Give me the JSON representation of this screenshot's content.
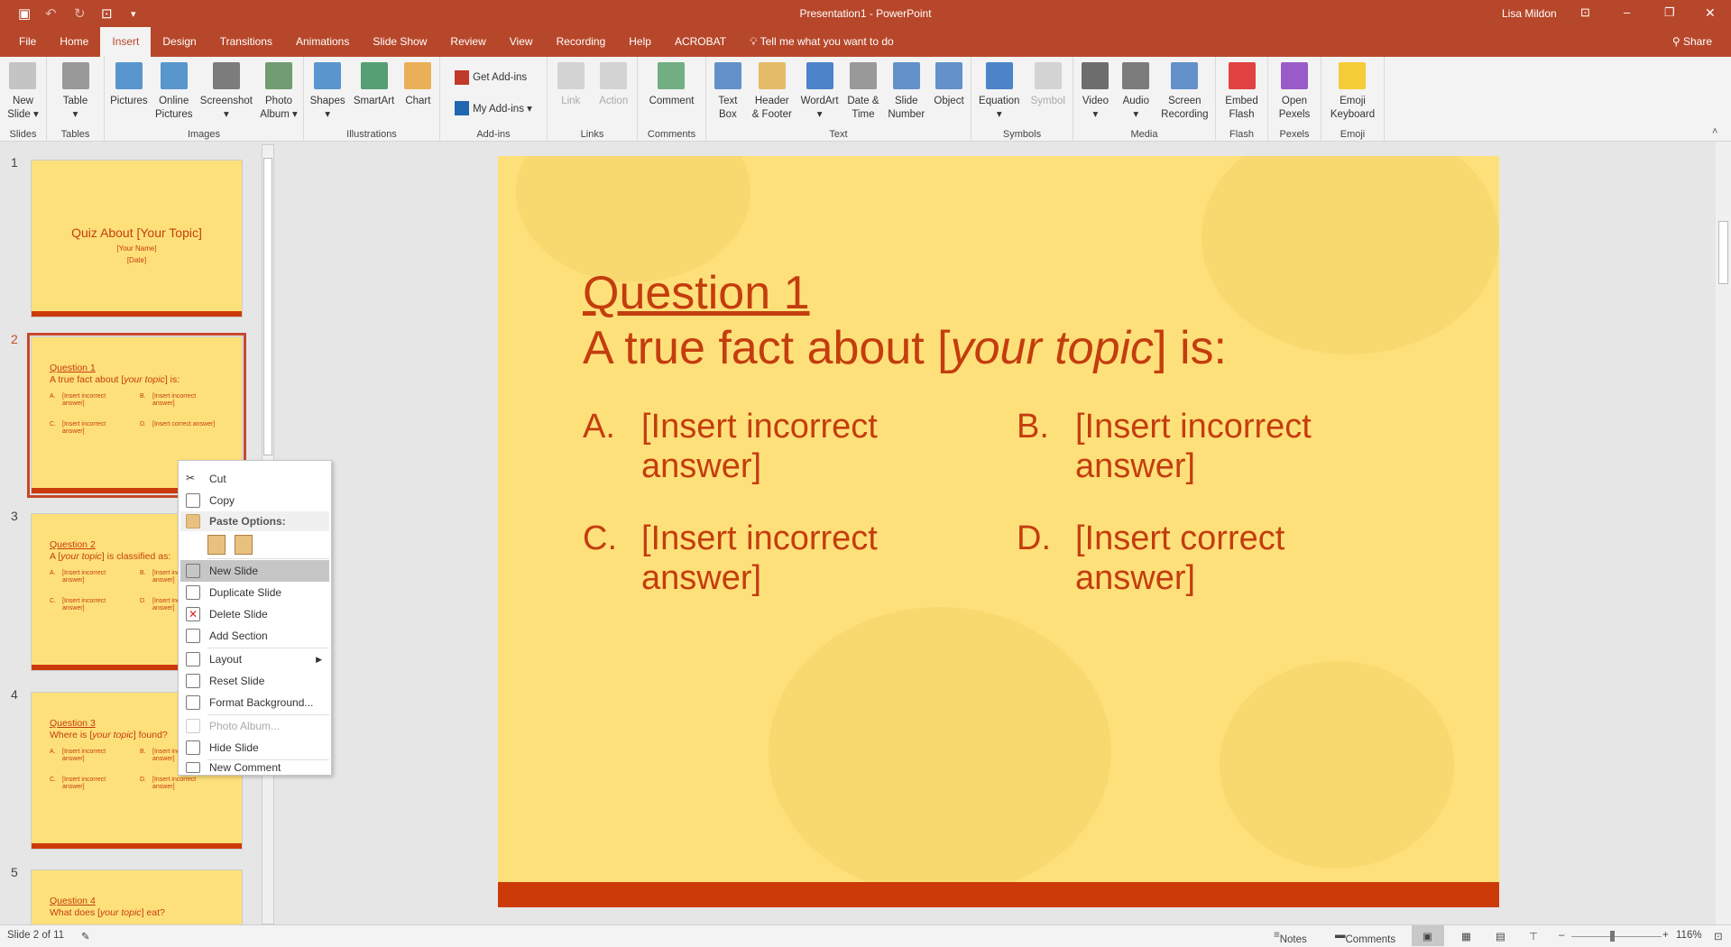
{
  "titlebar": {
    "title": "Presentation1  -  PowerPoint",
    "user": "Lisa Mildon"
  },
  "tabs": [
    "File",
    "Home",
    "Insert",
    "Design",
    "Transitions",
    "Animations",
    "Slide Show",
    "Review",
    "View",
    "Recording",
    "Help",
    "ACROBAT"
  ],
  "active_tab": "Insert",
  "tell_me": "Tell me what you want to do",
  "share": "Share",
  "ribbon": [
    {
      "label": "Slides",
      "w": 52,
      "items": [
        {
          "l1": "New",
          "l2": "Slide ▾",
          "c": "#bbb"
        }
      ]
    },
    {
      "label": "Tables",
      "w": 64,
      "items": [
        {
          "l1": "Table",
          "l2": "▾",
          "c": "#888"
        }
      ]
    },
    {
      "label": "Images",
      "w": 221,
      "items": [
        {
          "l1": "Pictures",
          "l2": "",
          "c": "#3d85c6"
        },
        {
          "l1": "Online",
          "l2": "Pictures",
          "c": "#3d85c6"
        },
        {
          "l1": "Screenshot",
          "l2": "▾",
          "c": "#666"
        },
        {
          "l1": "Photo",
          "l2": "Album ▾",
          "c": "#5b8c5a"
        }
      ]
    },
    {
      "label": "Illustrations",
      "w": 151,
      "items": [
        {
          "l1": "Shapes",
          "l2": "▾",
          "c": "#3d85c6"
        },
        {
          "l1": "SmartArt",
          "l2": "",
          "c": "#3a8e5c"
        },
        {
          "l1": "Chart",
          "l2": "",
          "c": "#e8a33d"
        }
      ]
    },
    {
      "label": "Add-ins",
      "w": 119,
      "small": [
        {
          "l": "Get Add-ins",
          "c": "#c0392b"
        },
        {
          "l": "My Add-ins ▾",
          "c": "#2166b0"
        }
      ]
    },
    {
      "label": "Links",
      "w": 100,
      "items": [
        {
          "l1": "Link",
          "l2": "",
          "c": "#ccc",
          "dis": true
        },
        {
          "l1": "Action",
          "l2": "",
          "c": "#ccc",
          "dis": true
        }
      ]
    },
    {
      "label": "Comments",
      "w": 76,
      "items": [
        {
          "l1": "Comment",
          "l2": "",
          "c": "#5aa06e"
        }
      ]
    },
    {
      "label": "Text",
      "w": 294,
      "items": [
        {
          "l1": "Text",
          "l2": "Box",
          "c": "#4a7fc1"
        },
        {
          "l1": "Header",
          "l2": "& Footer",
          "c": "#e0b050"
        },
        {
          "l1": "WordArt",
          "l2": "▾",
          "c": "#2f6fc1"
        },
        {
          "l1": "Date &",
          "l2": "Time",
          "c": "#888"
        },
        {
          "l1": "Slide",
          "l2": "Number",
          "c": "#4a7fc1"
        },
        {
          "l1": "Object",
          "l2": "",
          "c": "#4a7fc1"
        }
      ]
    },
    {
      "label": "Symbols",
      "w": 113,
      "items": [
        {
          "l1": "Equation",
          "l2": "▾",
          "c": "#2f6fc1"
        },
        {
          "l1": "Symbol",
          "l2": "",
          "c": "#ccc",
          "dis": true
        }
      ]
    },
    {
      "label": "Media",
      "w": 158,
      "items": [
        {
          "l1": "Video",
          "l2": "▾",
          "c": "#555"
        },
        {
          "l1": "Audio",
          "l2": "▾",
          "c": "#666"
        },
        {
          "l1": "Screen",
          "l2": "Recording",
          "c": "#4a7fc1"
        }
      ]
    },
    {
      "label": "Flash",
      "w": 58,
      "items": [
        {
          "l1": "Embed",
          "l2": "Flash",
          "c": "#d22"
        }
      ]
    },
    {
      "label": "Pexels",
      "w": 59,
      "items": [
        {
          "l1": "Open",
          "l2": "Pexels",
          "c": "#8a3fc1"
        }
      ]
    },
    {
      "label": "Emoji",
      "w": 70,
      "items": [
        {
          "l1": "Emoji",
          "l2": "Keyboard",
          "c": "#f5c518"
        }
      ]
    }
  ],
  "slides": [
    {
      "num": "1",
      "title": "Quiz About [Your Topic]",
      "sub1": "[Your Name]",
      "sub2": "[Date]"
    },
    {
      "num": "2",
      "q": "Question 1",
      "pre": "A true fact about [",
      "it": "your topic",
      "post": "] is:",
      "a": [
        "[Insert incorrect answer]",
        "[Insert incorrect answer]",
        "[Insert incorrect answer]",
        "[Insert correct answer]"
      ]
    },
    {
      "num": "3",
      "q": "Question 2",
      "pre": "A [",
      "it": "your topic",
      "post": "] is classified as:",
      "a": [
        "[Insert incorrect answer]",
        "[Insert incorrect answer]",
        "[Insert incorrect answer]",
        "[Insert incorrect answer]"
      ]
    },
    {
      "num": "4",
      "q": "Question 3",
      "pre": "Where is [",
      "it": "your topic",
      "post": "] found?",
      "a": [
        "[Insert incorrect answer]",
        "[Insert incorrect answer]",
        "[Insert incorrect answer]",
        "[Insert incorrect answer]"
      ]
    },
    {
      "num": "5",
      "q": "Question 4",
      "pre": "What does [",
      "it": "your topic",
      "post": "] eat?",
      "a": []
    }
  ],
  "main": {
    "q": "Question 1",
    "pre": "A true fact about [",
    "it": "your topic",
    "post": "] is:",
    "answers": [
      {
        "l": "A.",
        "t1": "[Insert incorrect",
        "t2": "answer]"
      },
      {
        "l": "B.",
        "t1": "[Insert incorrect",
        "t2": "answer]"
      },
      {
        "l": "C.",
        "t1": "[Insert incorrect",
        "t2": "answer]"
      },
      {
        "l": "D.",
        "t1": "[Insert correct",
        "t2": "answer]"
      }
    ]
  },
  "context_menu": {
    "cut": "Cut",
    "copy": "Copy",
    "paste_options": "Paste Options:",
    "new_slide": "New Slide",
    "duplicate": "Duplicate Slide",
    "delete": "Delete Slide",
    "add_section": "Add Section",
    "layout": "Layout",
    "reset": "Reset Slide",
    "format_bg": "Format Background...",
    "photo_album": "Photo Album...",
    "hide": "Hide Slide",
    "new_comment": "New Comment"
  },
  "status": {
    "slide": "Slide 2 of 11",
    "notes": "Notes",
    "comments": "Comments",
    "zoom": "116%",
    "zoom_percent": 116
  },
  "colors": {
    "accent": "#b7472a",
    "slide_bg": "#fee07a",
    "slide_text": "#c43d0d",
    "slide_bar": "#cc3a0a"
  }
}
